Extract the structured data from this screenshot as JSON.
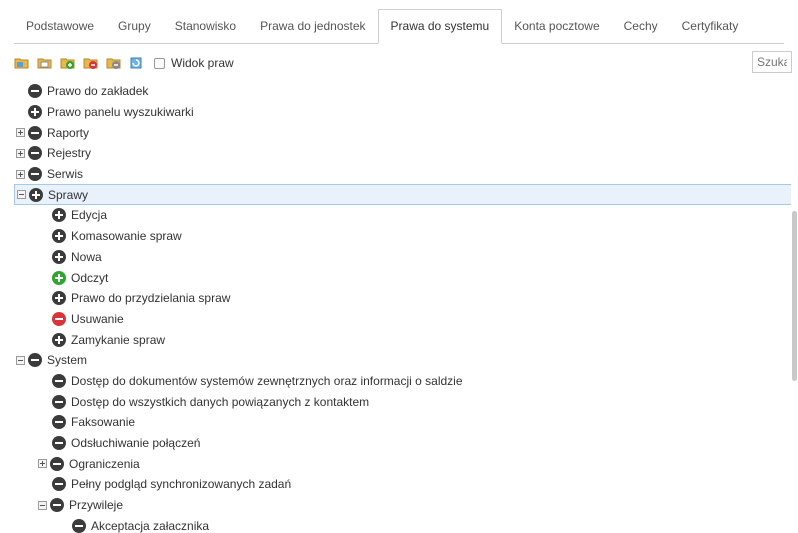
{
  "tabs": [
    {
      "label": "Podstawowe"
    },
    {
      "label": "Grupy"
    },
    {
      "label": "Stanowisko"
    },
    {
      "label": "Prawa do jednostek"
    },
    {
      "label": "Prawa do systemu",
      "active": true
    },
    {
      "label": "Konta pocztowe"
    },
    {
      "label": "Cechy"
    },
    {
      "label": "Certyfikaty"
    }
  ],
  "toolbar": {
    "buttons": [
      "folder-add-icon",
      "folder-copy-icon",
      "folder-green-icon",
      "folder-red-icon",
      "folder-gray-icon",
      "refresh-icon"
    ],
    "view_label": "Widok praw",
    "search_placeholder": "Szukaj"
  },
  "colors": {
    "dark": "#3b3b3b",
    "green": "#2fa52f",
    "red": "#d9343a",
    "selected_bg": "#e9f2fb"
  },
  "tree": [
    {
      "label": "Prawo do zakładek",
      "level": 0,
      "icon": "minus",
      "color": "dark",
      "expander": "none"
    },
    {
      "label": "Prawo panelu wyszukiwarki",
      "level": 0,
      "icon": "plus",
      "color": "dark",
      "expander": "none"
    },
    {
      "label": "Raporty",
      "level": 0,
      "icon": "minus",
      "color": "dark",
      "expander": "plus"
    },
    {
      "label": "Rejestry",
      "level": 0,
      "icon": "minus",
      "color": "dark",
      "expander": "plus"
    },
    {
      "label": "Serwis",
      "level": 0,
      "icon": "minus",
      "color": "dark",
      "expander": "plus"
    },
    {
      "label": "Sprawy",
      "level": 0,
      "icon": "plus",
      "color": "dark",
      "expander": "minus",
      "selected": true
    },
    {
      "label": "Edycja",
      "level": 1,
      "icon": "plus",
      "color": "dark",
      "expander": "none"
    },
    {
      "label": "Komasowanie spraw",
      "level": 1,
      "icon": "plus",
      "color": "dark",
      "expander": "none"
    },
    {
      "label": "Nowa",
      "level": 1,
      "icon": "plus",
      "color": "dark",
      "expander": "none"
    },
    {
      "label": "Odczyt",
      "level": 1,
      "icon": "plus",
      "color": "green",
      "expander": "none"
    },
    {
      "label": "Prawo do przydzielania spraw",
      "level": 1,
      "icon": "plus",
      "color": "dark",
      "expander": "none"
    },
    {
      "label": "Usuwanie",
      "level": 1,
      "icon": "minus",
      "color": "red",
      "expander": "none"
    },
    {
      "label": "Zamykanie spraw",
      "level": 1,
      "icon": "plus",
      "color": "dark",
      "expander": "none"
    },
    {
      "label": "System",
      "level": 0,
      "icon": "minus",
      "color": "dark",
      "expander": "minus"
    },
    {
      "label": "Dostęp do dokumentów systemów zewnętrznych oraz informacji o saldzie",
      "level": 1,
      "icon": "minus",
      "color": "dark",
      "expander": "none"
    },
    {
      "label": "Dostęp do wszystkich danych powiązanych z kontaktem",
      "level": 1,
      "icon": "minus",
      "color": "dark",
      "expander": "none"
    },
    {
      "label": "Faksowanie",
      "level": 1,
      "icon": "minus",
      "color": "dark",
      "expander": "none"
    },
    {
      "label": "Odsłuchiwanie połączeń",
      "level": 1,
      "icon": "minus",
      "color": "dark",
      "expander": "none"
    },
    {
      "label": "Ograniczenia",
      "level": 1,
      "icon": "minus",
      "color": "dark",
      "expander": "plus"
    },
    {
      "label": "Pełny podgląd synchronizowanych zadań",
      "level": 1,
      "icon": "minus",
      "color": "dark",
      "expander": "none"
    },
    {
      "label": "Przywileje",
      "level": 1,
      "icon": "minus",
      "color": "dark",
      "expander": "minus"
    },
    {
      "label": "Akceptacja załacznika",
      "level": 2,
      "icon": "minus",
      "color": "dark",
      "expander": "none"
    }
  ]
}
